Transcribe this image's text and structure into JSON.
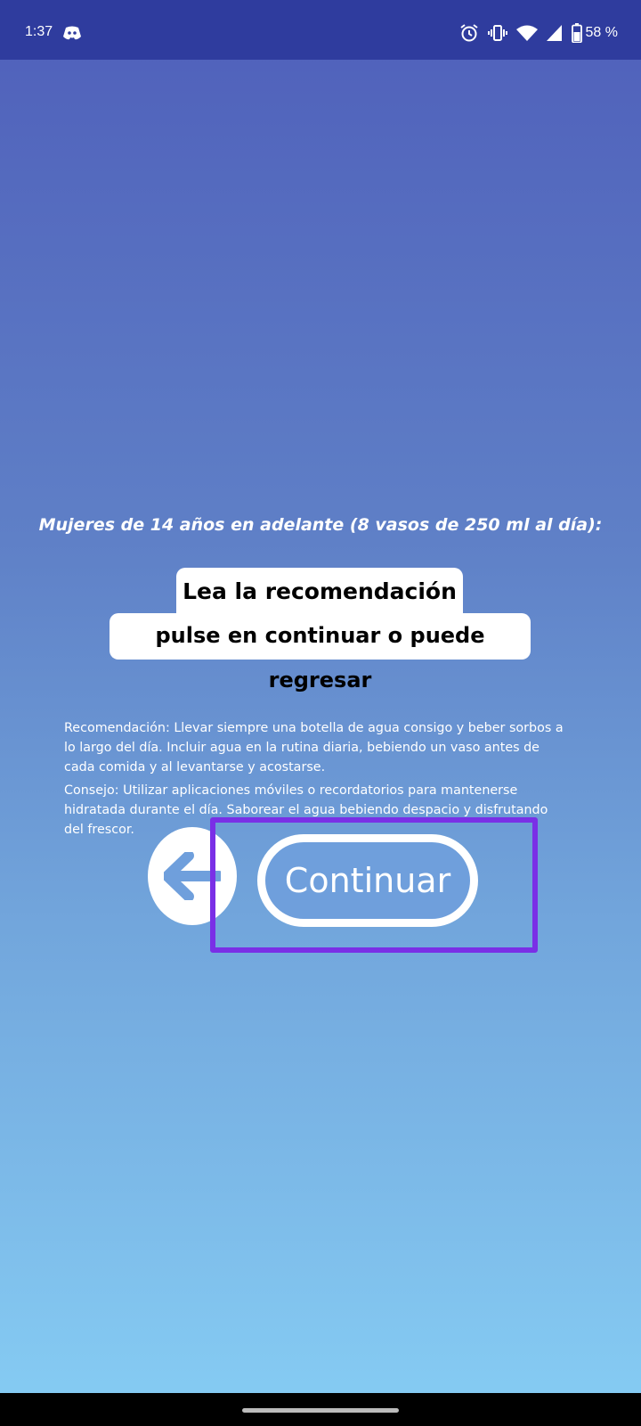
{
  "status_bar": {
    "time": "1:37",
    "battery_text": "58 %",
    "icons": [
      "discord-icon",
      "alarm-icon",
      "vibrate-icon",
      "wifi-icon",
      "signal-icon",
      "battery-icon"
    ]
  },
  "screen": {
    "heading": "Mujeres de 14 años en adelante (8 vasos de 250 ml al día):",
    "instruction_line_1": "Lea la recomendación y",
    "instruction_line_2": "pulse en continuar o puede regresar",
    "recommendation": "Recomendación: Llevar siempre una botella de agua consigo y beber sorbos a lo largo del día. Incluir agua en la rutina diaria, bebiendo un vaso antes de cada comida y al levantarse y acostarse.",
    "tip": "Consejo: Utilizar aplicaciones móviles o recordatorios para mantenerse hidratada durante el día. Saborear el agua bebiendo despacio y disfrutando del frescor.",
    "back_icon": "arrow-left-icon",
    "continue_label": "Continuar"
  },
  "colors": {
    "status_bar": "#2f3c9e",
    "gradient_top": "#4f5fba",
    "gradient_bottom": "#86cdf4",
    "highlight": "#7a2fe6",
    "button_fill": "#6f9fdc"
  }
}
